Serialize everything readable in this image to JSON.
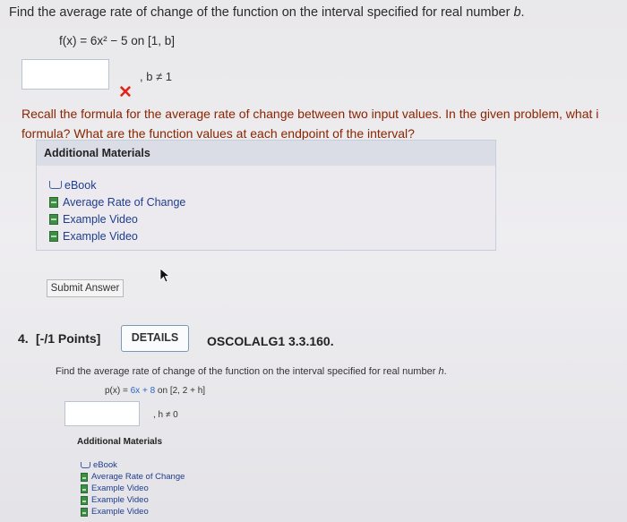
{
  "q3": {
    "prompt_prefix": "Find the average rate of change of the function on the interval specified for real number ",
    "prompt_var": "b",
    "prompt_suffix": ".",
    "equation": "f(x) = 6x² − 5  on  [1, b]",
    "answer_value": "",
    "condition": ", b ≠ 1",
    "result_icon": "red-x-icon",
    "hint_line1": "Recall the formula for the average rate of change between two input values. In the given problem, what i",
    "hint_line2": "formula? What are the function values at each endpoint of the interval?",
    "materials_title": "Additional Materials",
    "materials": [
      {
        "label": "eBook",
        "icon": "ebook-icon"
      },
      {
        "label": "Average Rate of Change",
        "icon": "document-icon"
      },
      {
        "label": "Example Video",
        "icon": "document-icon"
      },
      {
        "label": "Example Video",
        "icon": "document-icon"
      }
    ],
    "submit_label": "Submit Answer"
  },
  "q4": {
    "number": "4.",
    "points": "[-/1 Points]",
    "details_label": "DETAILS",
    "code": "OSCOLALG1 3.3.160.",
    "prompt_prefix": "Find the average rate of change of the function on the interval specified for real number ",
    "prompt_var": "h",
    "prompt_suffix": ".",
    "equation_lhs": "p(x) = ",
    "equation_terms": "6x + 8",
    "equation_rhs": "  on  [2, 2 + h]",
    "answer_value": "",
    "condition": ", h ≠ 0",
    "materials_title": "Additional Materials",
    "materials": [
      {
        "label": "eBook",
        "icon": "ebook-icon"
      },
      {
        "label": "Average Rate of Change",
        "icon": "document-icon"
      },
      {
        "label": "Example Video",
        "icon": "document-icon"
      },
      {
        "label": "Example Video",
        "icon": "document-icon"
      },
      {
        "label": "Example Video",
        "icon": "document-icon"
      }
    ]
  },
  "colors": {
    "error": "#e2231a",
    "hint": "#8a2500",
    "link": "#1f3d8f",
    "equation_highlight": "#2a66c8"
  }
}
